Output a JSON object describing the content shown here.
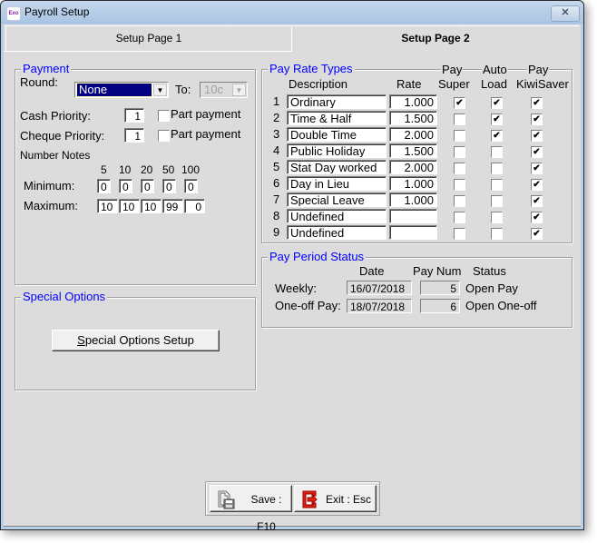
{
  "window": {
    "title": "Payroll Setup",
    "app_icon_label": "Exo",
    "close_glyph": "✕"
  },
  "tabs": [
    {
      "label": "Setup Page 1",
      "active": false
    },
    {
      "label": "Setup Page 2",
      "active": true
    }
  ],
  "payment": {
    "legend": "Payment",
    "round_label": "Round:",
    "round_value": "None",
    "to_label": "To:",
    "to_value": "10c",
    "cash_priority_label": "Cash Priority:",
    "cash_priority_value": "1",
    "cash_part_payment_label": "Part payment",
    "cash_part_payment_checked": false,
    "cheque_priority_label": "Cheque Priority:",
    "cheque_priority_value": "1",
    "cheque_part_payment_label": "Part payment",
    "cheque_part_payment_checked": false,
    "number_notes_label": "Number Notes",
    "note_denominations": [
      "5",
      "10",
      "20",
      "50",
      "100"
    ],
    "minimum_label": "Minimum:",
    "minimum_values": [
      "0",
      "0",
      "0",
      "0",
      "0"
    ],
    "maximum_label": "Maximum:",
    "maximum_values": [
      "10",
      "10",
      "10",
      "99",
      "0"
    ]
  },
  "special_options": {
    "legend": "Special Options",
    "button_label_accel": "S",
    "button_label_rest": "pecial Options Setup"
  },
  "pay_rate_types": {
    "legend": "Pay Rate Types",
    "headers": {
      "description": "Description",
      "rate": "Rate",
      "pay_super_top": "Pay",
      "pay_super_bottom": "Super",
      "auto_load_top": "Auto",
      "auto_load_bottom": "Load",
      "kiwisaver_top": "Pay",
      "kiwisaver_bottom": "KiwiSaver"
    },
    "rows": [
      {
        "num": "1",
        "description": "Ordinary",
        "rate": "1.000",
        "pay_super": true,
        "auto_load": true,
        "kiwisaver": true
      },
      {
        "num": "2",
        "description": "Time & Half",
        "rate": "1.500",
        "pay_super": false,
        "auto_load": true,
        "kiwisaver": true
      },
      {
        "num": "3",
        "description": "Double Time",
        "rate": "2.000",
        "pay_super": false,
        "auto_load": true,
        "kiwisaver": true
      },
      {
        "num": "4",
        "description": "Public Holiday",
        "rate": "1.500",
        "pay_super": false,
        "auto_load": false,
        "kiwisaver": true
      },
      {
        "num": "5",
        "description": "Stat Day worked",
        "rate": "2.000",
        "pay_super": false,
        "auto_load": false,
        "kiwisaver": true
      },
      {
        "num": "6",
        "description": "Day in Lieu",
        "rate": "1.000",
        "pay_super": false,
        "auto_load": false,
        "kiwisaver": true
      },
      {
        "num": "7",
        "description": "Special Leave",
        "rate": "1.000",
        "pay_super": false,
        "auto_load": false,
        "kiwisaver": true
      },
      {
        "num": "8",
        "description": "Undefined",
        "rate": "",
        "pay_super": false,
        "auto_load": false,
        "kiwisaver": true
      },
      {
        "num": "9",
        "description": "Undefined",
        "rate": "",
        "pay_super": false,
        "auto_load": false,
        "kiwisaver": true
      }
    ]
  },
  "pay_period_status": {
    "legend": "Pay Period Status",
    "headers": {
      "date": "Date",
      "pay_num": "Pay Num",
      "status": "Status"
    },
    "rows": [
      {
        "label": "Weekly:",
        "date": "16/07/2018",
        "pay_num": "5",
        "status": "Open Pay"
      },
      {
        "label": "One-off Pay:",
        "date": "18/07/2018",
        "pay_num": "6",
        "status": "Open One-off"
      }
    ]
  },
  "footer": {
    "save_label": "Save : F10",
    "exit_label": "Exit : Esc"
  },
  "check_glyph": "✔"
}
